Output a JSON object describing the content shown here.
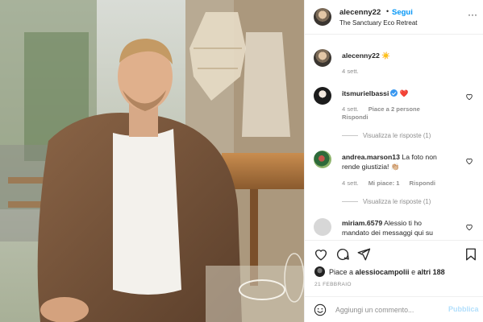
{
  "post": {
    "author": "alecenny22",
    "follow_dot": "•",
    "follow_label": "Segui",
    "location": "The Sanctuary Eco Retreat",
    "more_glyph": "···"
  },
  "caption": {
    "username": "alecenny22",
    "text": "☀️",
    "time": "4 sett."
  },
  "comments": [
    {
      "username": "itsmurielbassi",
      "verified": true,
      "text": "❤️",
      "time": "4 sett.",
      "likes": "Piace a 2 persone",
      "reply": "Rispondi",
      "show_replies": "Visualizza le risposte (1)"
    },
    {
      "username": "andrea.marson13",
      "text_line1": "La foto non",
      "text_line2": "rende giustizia! 👏🏼",
      "time": "4 sett.",
      "likes": "Mi piace: 1",
      "reply": "Rispondi",
      "show_replies": "Visualizza le risposte (1)"
    },
    {
      "username": "miriam.6579",
      "text_line1": "Alessio ti ho",
      "text_line2": "mandato dei messaggi qui su"
    }
  ],
  "actions": {
    "like_icon": "heart-icon",
    "comment_icon": "comment-icon",
    "share_icon": "paper-plane-icon",
    "save_icon": "bookmark-icon"
  },
  "likes_summary": {
    "prefix": "Piace a ",
    "user": "alessiocampolii",
    "middle": " e ",
    "others": "altri 188"
  },
  "date": "21 FEBBRAIO",
  "add_comment": {
    "placeholder": "Aggiungi un commento...",
    "publish_label": "Pubblica"
  },
  "colors": {
    "link_blue": "#0095f6",
    "publish_disabled": "#b2dffc",
    "muted": "#8e8e8e",
    "text": "#262626",
    "heart_red": "#ed4956"
  }
}
